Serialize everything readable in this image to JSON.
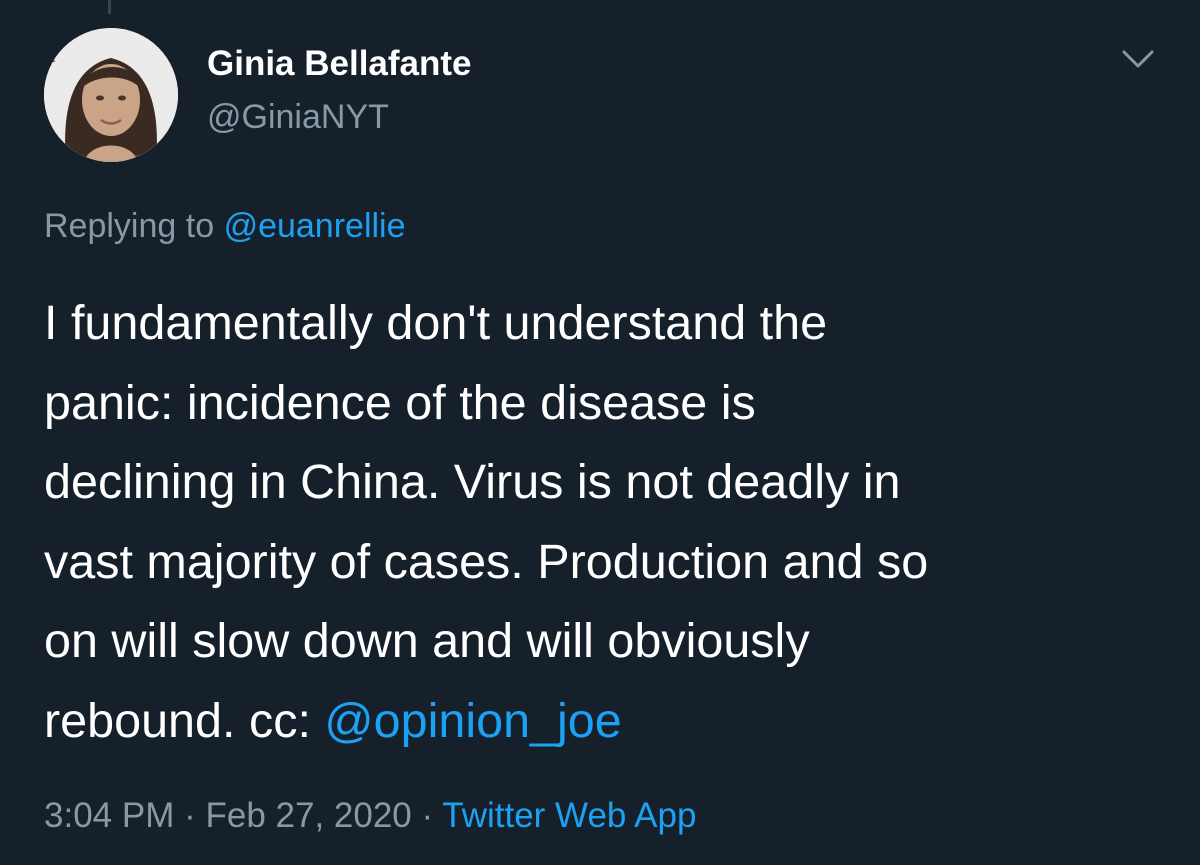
{
  "author": {
    "display_name": "Ginia Bellafante",
    "handle": "@GiniaNYT"
  },
  "reply_context": {
    "prefix": "Replying to",
    "mention": "@euanrellie"
  },
  "tweet": {
    "lines": [
      "I fundamentally don't understand the",
      "panic: incidence of the disease is",
      "declining in China. Virus is not deadly in",
      "vast majority of cases. Production and so",
      "on will slow down and will obviously",
      "rebound. cc:"
    ],
    "mention": "@opinion_joe"
  },
  "meta": {
    "time": "3:04 PM",
    "separator_1": "·",
    "date": "Feb 27, 2020",
    "separator_2": "·",
    "source": "Twitter Web App"
  },
  "colors": {
    "background": "#15202b",
    "text": "#ffffff",
    "secondary_text": "#8899a6",
    "link": "#1da1f2"
  },
  "icons": {
    "more_options": "chevron-down-icon",
    "avatar": "profile-photo"
  }
}
